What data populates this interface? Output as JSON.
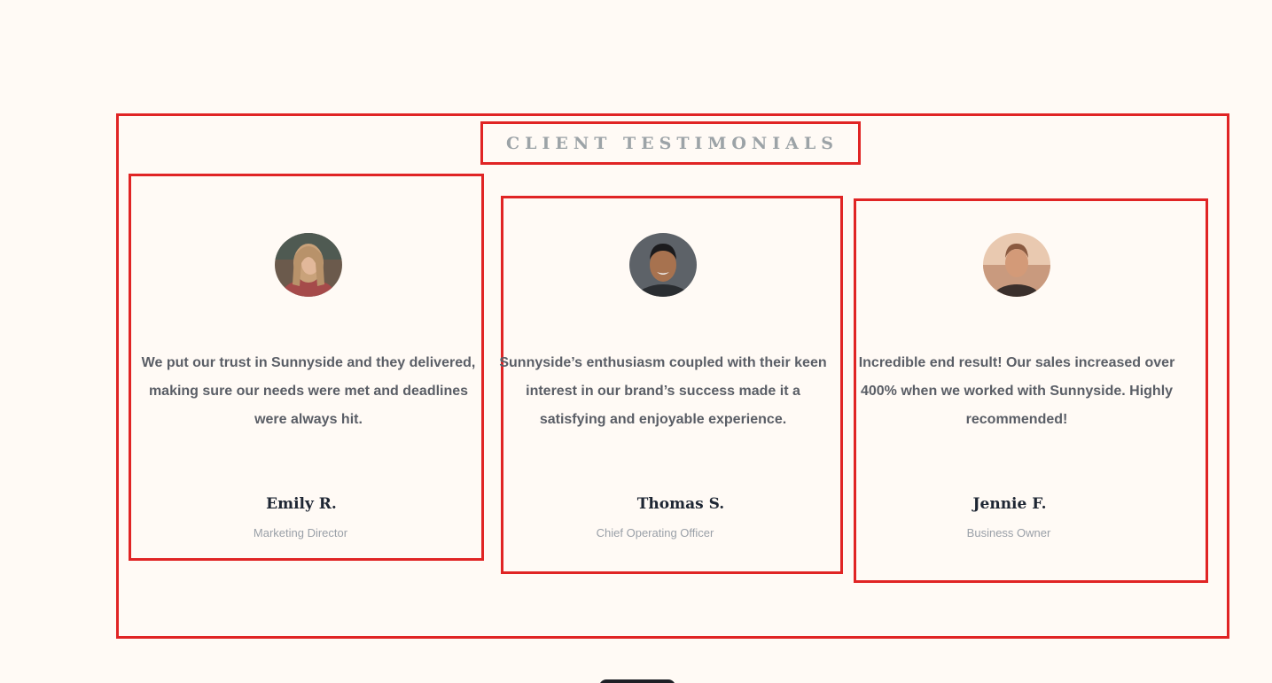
{
  "section": {
    "heading": "CLIENT TESTIMONIALS"
  },
  "testimonials": [
    {
      "quote": "We put our trust in Sunnyside and they delivered, making sure our needs were met and deadlines were always hit.",
      "name": "Emily R.",
      "role": "Marketing Director",
      "avatar": "portrait-woman-long-hair"
    },
    {
      "quote": "Sunnyside’s enthusiasm coupled with their keen interest in our brand’s success made it a satisfying and enjoyable experience.",
      "name": "Thomas S.",
      "role": "Chief Operating Officer",
      "avatar": "portrait-man-smiling"
    },
    {
      "quote": "Incredible end result! Our sales increased over 400% when we worked with Sunnyside. Highly recommended!",
      "name": "Jennie F.",
      "role": "Business Owner",
      "avatar": "portrait-woman-short-hair"
    }
  ],
  "colors": {
    "background": "#fffaf5",
    "outline": "#e02424",
    "heading": "#9ca3a7",
    "body_text": "#5a5e66",
    "name_text": "#1e2633",
    "role_text": "#9aa0a8"
  }
}
